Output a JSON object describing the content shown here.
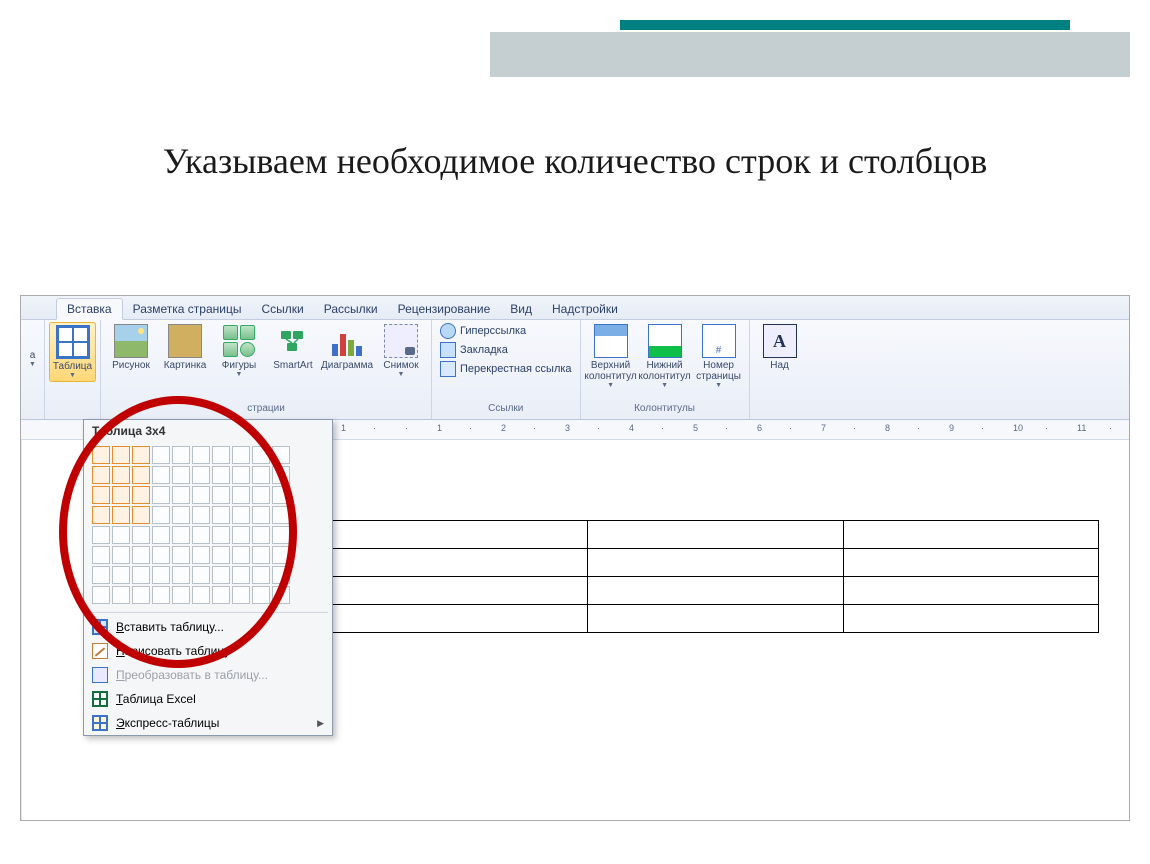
{
  "slide": {
    "title": "Указываем необходимое количество строк и столбцов"
  },
  "ribbon": {
    "tabs": [
      "Вставка",
      "Разметка страницы",
      "Ссылки",
      "Рассылки",
      "Рецензирование",
      "Вид",
      "Надстройки"
    ],
    "active_tab_index": 0,
    "left_stub_label": "а",
    "groups": {
      "tables": {
        "label": "",
        "items": {
          "table": "Таблица"
        }
      },
      "illustrations": {
        "label": "страции",
        "items": {
          "picture": "Рисунок",
          "clipart": "Картинка",
          "shapes": "Фигуры",
          "smartart": "SmartArt",
          "chart": "Диаграмма",
          "screenshot": "Снимок"
        }
      },
      "links": {
        "label": "Ссылки",
        "items": {
          "hyperlink": "Гиперссылка",
          "bookmark": "Закладка",
          "crossref": "Перекрестная ссылка"
        }
      },
      "headerfooter": {
        "label": "Колонтитулы",
        "items": {
          "header": "Верхний колонтитул",
          "footer": "Нижний колонтитул",
          "pagenum": "Номер страницы"
        }
      },
      "text": {
        "label": "",
        "items": {
          "textbox": "Над"
        }
      }
    }
  },
  "table_dropdown": {
    "header": "Таблица 3x4",
    "selected": {
      "cols": 3,
      "rows": 4
    },
    "grid": {
      "cols": 10,
      "rows": 8
    },
    "menu": {
      "insert": "Вставить таблицу...",
      "draw": "Нарисовать таблицу",
      "convert": "Преобразовать в таблицу...",
      "excel": "Таблица Excel",
      "express": "Экспресс-таблицы"
    }
  },
  "ruler": {
    "numbers": [
      "1",
      "·",
      "·",
      "1",
      "·",
      "2",
      "·",
      "3",
      "·",
      "4",
      "·",
      "5",
      "·",
      "6",
      "·",
      "7",
      "·",
      "8",
      "·",
      "9",
      "·",
      "10",
      "·",
      "11",
      "·"
    ]
  },
  "preview_table": {
    "rows": 4,
    "cols": 3
  }
}
